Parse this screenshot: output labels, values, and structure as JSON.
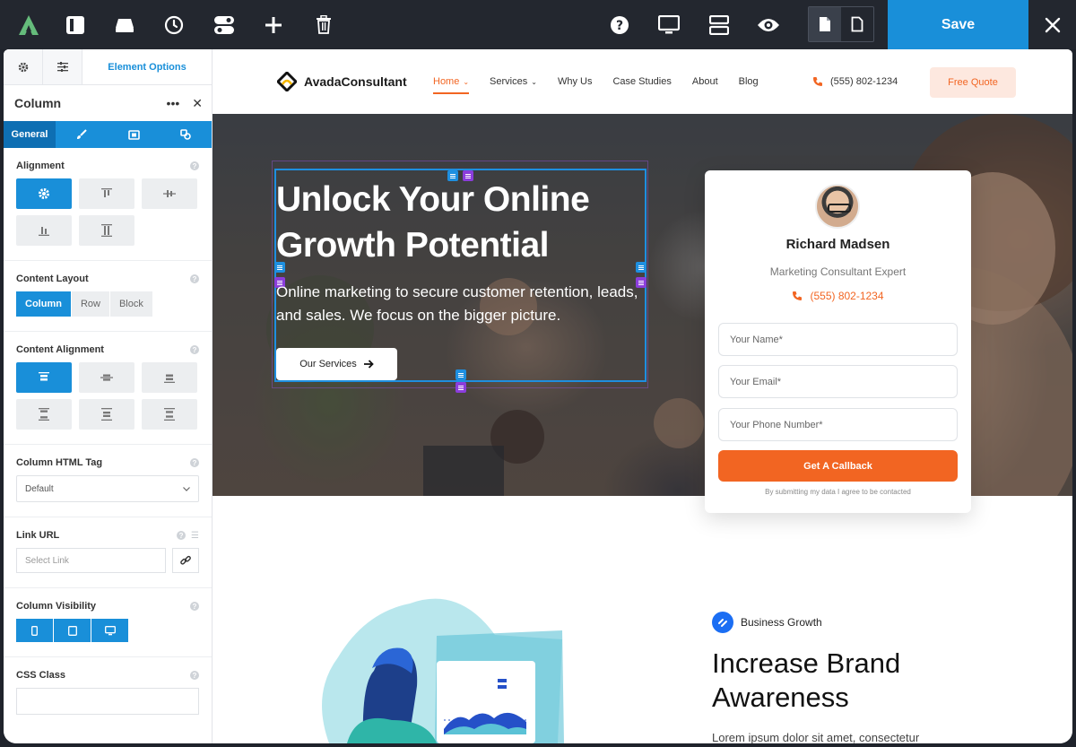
{
  "toolbar": {
    "icons": [
      "avada-logo-icon",
      "sidebar-toggle-icon",
      "library-icon",
      "history-icon",
      "toggles-icon",
      "add-icon",
      "trash-icon",
      "help-icon",
      "desktop-icon",
      "layout-icon",
      "preview-icon",
      "page-icon",
      "page-outline-icon"
    ],
    "save_label": "Save"
  },
  "sidebar": {
    "tab_label": "Element Options",
    "panel_title": "Column",
    "subtabs": [
      "General"
    ],
    "alignment_label": "Alignment",
    "content_layout_label": "Content Layout",
    "content_layout_options": [
      "Column",
      "Row",
      "Block"
    ],
    "content_alignment_label": "Content Alignment",
    "html_tag_label": "Column HTML Tag",
    "html_tag_value": "Default",
    "link_url_label": "Link URL",
    "link_url_placeholder": "Select Link",
    "visibility_label": "Column Visibility",
    "css_class_label": "CSS Class"
  },
  "site": {
    "brand": "AvadaConsultant",
    "menu": [
      "Home",
      "Services",
      "Why Us",
      "Case Studies",
      "About",
      "Blog"
    ],
    "phone": "(555) 802-1234",
    "quote_label": "Free Quote",
    "hero_title": "Unlock Your Online Growth Potential",
    "hero_subtitle": "Online marketing to secure customer retention, leads, and sales. We focus on the bigger picture.",
    "hero_button": "Our Services",
    "card": {
      "name": "Richard Madsen",
      "role": "Marketing Consultant Expert",
      "phone": "(555) 802-1234",
      "fields": [
        "Your Name*",
        "Your Email*",
        "Your Phone Number*"
      ],
      "cta": "Get A Callback",
      "note": "By submitting my data I agree to be contacted"
    },
    "section": {
      "eyebrow": "Business Growth",
      "title": "Increase Brand Awareness",
      "body": "Lorem ipsum dolor sit amet, consectetur"
    }
  },
  "colors": {
    "accent": "#198fd9",
    "orange": "#f26522",
    "toolbar": "#23272f"
  }
}
